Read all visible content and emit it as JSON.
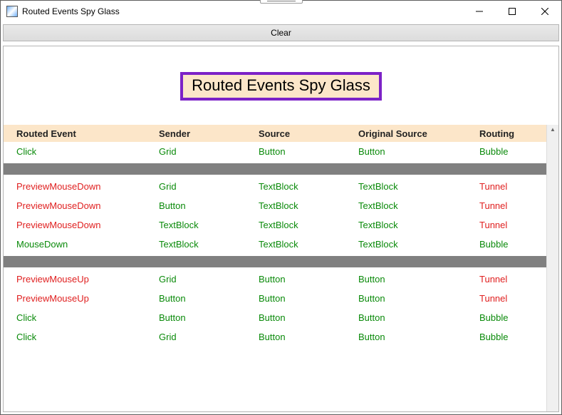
{
  "window": {
    "title": "Routed Events Spy Glass"
  },
  "toolbar": {
    "clear_label": "Clear"
  },
  "hero": {
    "title": "Routed Events Spy Glass"
  },
  "columns": {
    "c0": "Routed Event",
    "c1": "Sender",
    "c2": "Source",
    "c3": "Original Source",
    "c4": "Routing"
  },
  "colors": {
    "bubble": "#0a8a0a",
    "tunnel": "#e02020",
    "header_bg": "#fce6c9",
    "accent_border": "#7c22c7",
    "divider": "#808080"
  },
  "groups": [
    {
      "rows": [
        {
          "event": "Click",
          "sender": "Grid",
          "source": "Button",
          "orig": "Button",
          "routing": "Bubble"
        }
      ]
    },
    {
      "rows": [
        {
          "event": "PreviewMouseDown",
          "sender": "Grid",
          "source": "TextBlock",
          "orig": "TextBlock",
          "routing": "Tunnel"
        },
        {
          "event": "PreviewMouseDown",
          "sender": "Button",
          "source": "TextBlock",
          "orig": "TextBlock",
          "routing": "Tunnel"
        },
        {
          "event": "PreviewMouseDown",
          "sender": "TextBlock",
          "source": "TextBlock",
          "orig": "TextBlock",
          "routing": "Tunnel"
        },
        {
          "event": "MouseDown",
          "sender": "TextBlock",
          "source": "TextBlock",
          "orig": "TextBlock",
          "routing": "Bubble"
        }
      ]
    },
    {
      "rows": [
        {
          "event": "PreviewMouseUp",
          "sender": "Grid",
          "source": "Button",
          "orig": "Button",
          "routing": "Tunnel"
        },
        {
          "event": "PreviewMouseUp",
          "sender": "Button",
          "source": "Button",
          "orig": "Button",
          "routing": "Tunnel"
        },
        {
          "event": "Click",
          "sender": "Button",
          "source": "Button",
          "orig": "Button",
          "routing": "Bubble"
        },
        {
          "event": "Click",
          "sender": "Grid",
          "source": "Button",
          "orig": "Button",
          "routing": "Bubble"
        }
      ]
    }
  ]
}
